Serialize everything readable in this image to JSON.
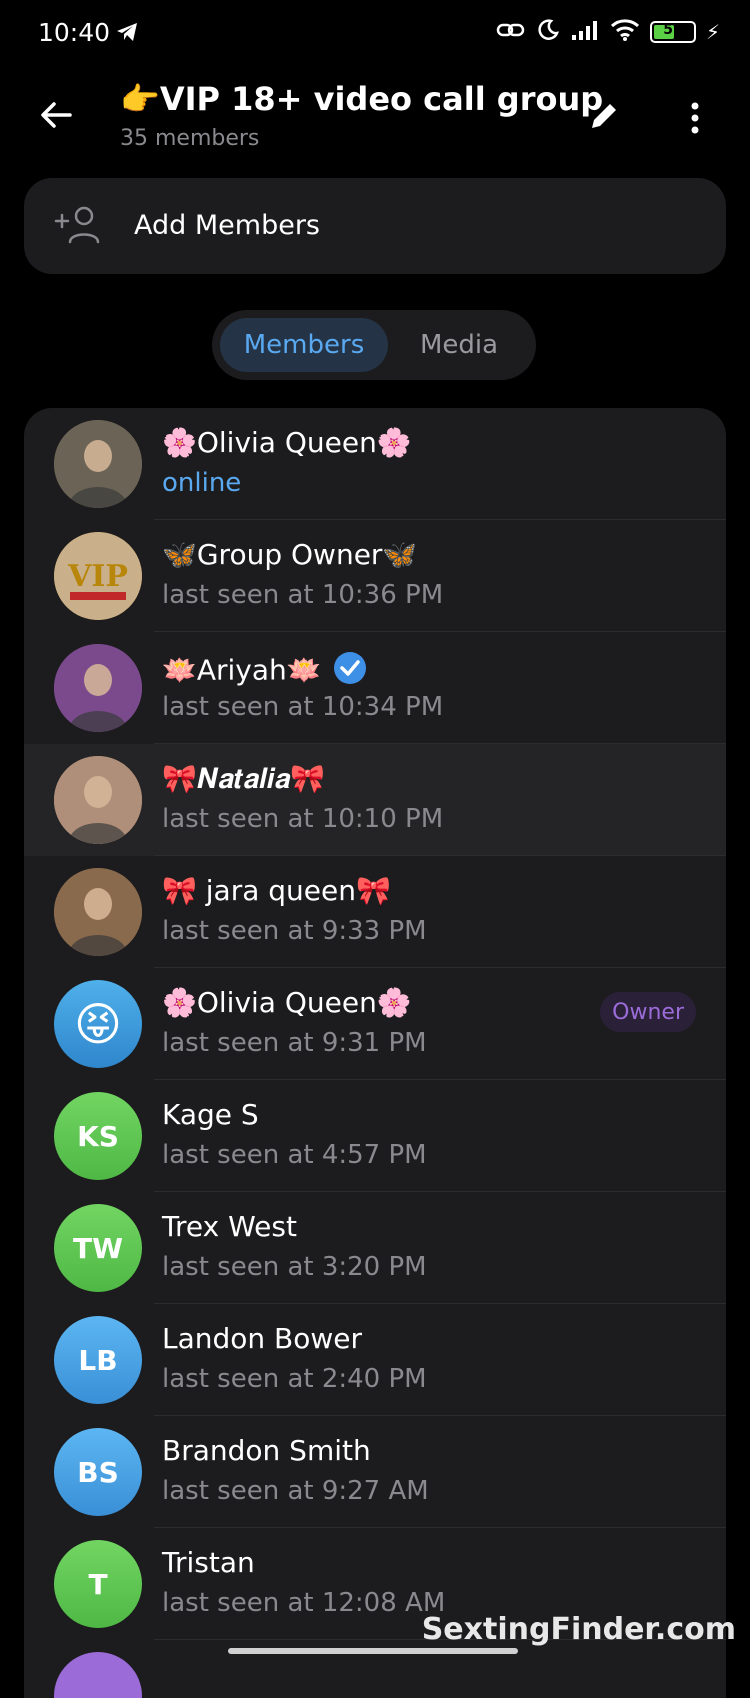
{
  "status_bar": {
    "time": "10:40",
    "battery": "52",
    "battery_level": 0.52
  },
  "header": {
    "title": "👉VIP 18+ video call group",
    "subtitle": "35 members"
  },
  "add_members": {
    "label": "Add Members"
  },
  "tabs": [
    {
      "label": "Members",
      "active": true
    },
    {
      "label": "Media",
      "active": false
    }
  ],
  "members": [
    {
      "name": "🌸Olivia Queen🌸",
      "status": "online",
      "avatar": "photo",
      "avatar_color": "#6b6456"
    },
    {
      "name": "🦋Group Owner🦋",
      "status": "last seen at 10:36 PM",
      "avatar": "vip-logo",
      "avatar_color": "#c9a15a"
    },
    {
      "name": "🪷Ariyah🪷",
      "status": "last seen at 10:34 PM",
      "avatar": "photo",
      "avatar_color": "#7a4a8c",
      "verified": true
    },
    {
      "name": "🎀𝑵𝒂𝒕𝒂𝒍𝒊𝒂🎀",
      "status": "last seen at 10:10 PM",
      "avatar": "photo",
      "avatar_color": "#b08f7a"
    },
    {
      "name": "🎀 jara queen🎀",
      "status": "last seen at 9:33 PM",
      "avatar": "photo",
      "avatar_color": "#8a6a4c"
    },
    {
      "name": "🌸Olivia Queen🌸",
      "status": "last seen at 9:31 PM",
      "avatar": "emoji",
      "avatar_emoji": "😝",
      "avatar_color": "#3a9ad9",
      "badge": "Owner"
    },
    {
      "name": "Kage S",
      "status": "last seen at 4:57 PM",
      "avatar": "initials",
      "initials": "KS",
      "avatar_color": "#5cc254"
    },
    {
      "name": "Trex West",
      "status": "last seen at 3:20 PM",
      "avatar": "initials",
      "initials": "TW",
      "avatar_color": "#5cc254"
    },
    {
      "name": "Landon Bower",
      "status": "last seen at 2:40 PM",
      "avatar": "initials",
      "initials": "LB",
      "avatar_color": "#3d9ee0"
    },
    {
      "name": "Brandon Smith",
      "status": "last seen at 9:27 AM",
      "avatar": "initials",
      "initials": "BS",
      "avatar_color": "#3d9ee0"
    },
    {
      "name": "Tristan",
      "status": "last seen at 12:08 AM",
      "avatar": "initials",
      "initials": "T",
      "avatar_color": "#5cc254"
    },
    {
      "name": "",
      "status": "",
      "avatar": "initials",
      "initials": "",
      "avatar_color": "#9b6bd8"
    }
  ],
  "watermark": "SextingFinder.com"
}
